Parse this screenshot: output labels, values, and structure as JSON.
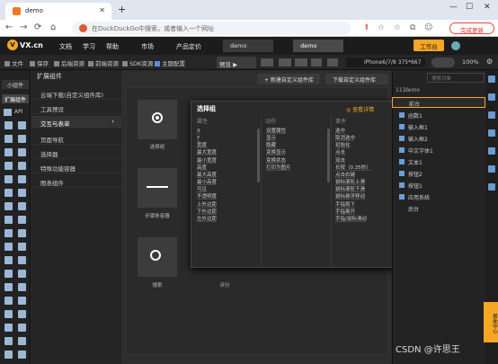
{
  "browser": {
    "tab_title": "demo",
    "address_placeholder": "在DuckDuckGo中搜索，或者输入一个网址",
    "update_button": "完成更新"
  },
  "menubar": {
    "brand": "VX.cn",
    "items": [
      "文档",
      "学习",
      "帮助",
      "市场",
      "产品定价"
    ],
    "doc_tabs": [
      "demo",
      "demo"
    ],
    "workbench_button": "工作台"
  },
  "toolbar": {
    "items": [
      "文件",
      "保存",
      "后端资源",
      "前端资源",
      "SDK资源",
      "主题配置"
    ],
    "preview_label": "预览",
    "device": "iPhone6/7/8 375*667",
    "zoom": "100%"
  },
  "leftbar": {
    "tabs": [
      "小组件",
      "扩展组件"
    ],
    "api_label": "API"
  },
  "panel": {
    "title": "扩展组件",
    "items": [
      "云端下载(自定义组件库)",
      "工具预设",
      "交互与表单",
      "页面导航",
      "选择器",
      "特殊功能容器",
      "图表组件"
    ],
    "selected_index": 2
  },
  "canvas": {
    "btn_new": "+ 新建自定义组件库",
    "btn_download": "下载自定义组件库",
    "cards": [
      "选择组",
      "步骤条容器",
      "搜索",
      "评分"
    ]
  },
  "popup": {
    "title": "选择组",
    "link": "查看详情",
    "col_props": "属性",
    "col_actions": "动作",
    "col_events": "事件",
    "props": [
      "X",
      "Y",
      "宽度",
      "最大宽度",
      "最小宽度",
      "高度",
      "最大高度",
      "最小高度",
      "可见",
      "不透明度",
      "上外边距",
      "下外边距",
      "左外边距"
    ],
    "actions": [
      "设置属性",
      "显示",
      "隐藏",
      "变换显示",
      "变换状态",
      "打印为图片"
    ],
    "events": [
      "选中",
      "取消选中",
      "初始化",
      "点击",
      "双击",
      "长按（0.35秒）",
      "点击右键",
      "鼠标滚轮上滑",
      "鼠标滚轮下滑",
      "鼠标悬浮移动",
      "手指按下",
      "手指离开",
      "手指/鼠标滑动"
    ]
  },
  "rightpanel": {
    "tab": "11]demo",
    "search": "搜索对象",
    "items": [
      "前台",
      "函数1",
      "输入框1",
      "输入框2",
      "中文字体1",
      "文本1",
      "按钮2",
      "按钮1",
      "应用系统",
      "后台"
    ],
    "selected_index": 0
  },
  "side_tab": "帮助中心",
  "watermark": "CSDN @许思王"
}
